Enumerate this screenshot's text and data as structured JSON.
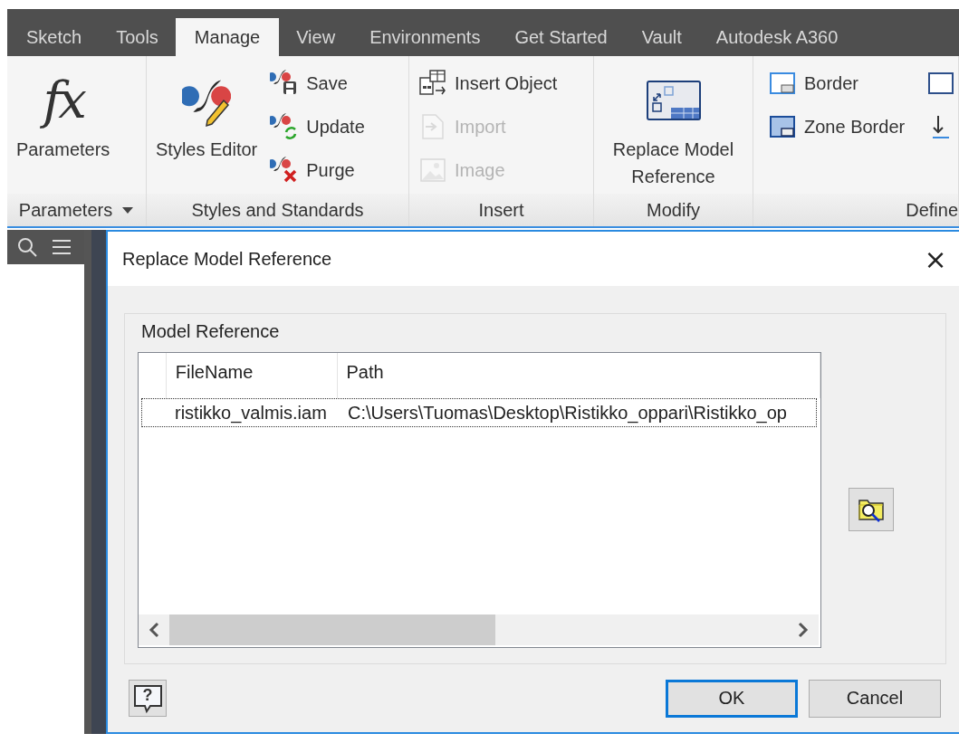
{
  "tabs": [
    {
      "label": "Sketch",
      "selected": false
    },
    {
      "label": "Tools",
      "selected": false
    },
    {
      "label": "Manage",
      "selected": true
    },
    {
      "label": "View",
      "selected": false
    },
    {
      "label": "Environments",
      "selected": false
    },
    {
      "label": "Get Started",
      "selected": false
    },
    {
      "label": "Vault",
      "selected": false
    },
    {
      "label": "Autodesk A360",
      "selected": false
    }
  ],
  "ribbon": {
    "panels": [
      {
        "label": "Parameters",
        "dropdown": true,
        "tools": [
          {
            "kind": "large",
            "icon_text": "fx",
            "label": "Parameters",
            "disabled": false
          }
        ]
      },
      {
        "label": "Styles and Standards",
        "dropdown": false,
        "tools": [
          {
            "kind": "large",
            "label": "Styles Editor",
            "disabled": false
          },
          {
            "kind": "stack",
            "tools": [
              {
                "label": "Save",
                "disabled": false
              },
              {
                "label": "Update",
                "disabled": false
              },
              {
                "label": "Purge",
                "disabled": false
              }
            ]
          }
        ]
      },
      {
        "label": "Insert",
        "dropdown": false,
        "tools": [
          {
            "kind": "stack",
            "tools": [
              {
                "label": "Insert Object",
                "disabled": false
              },
              {
                "label": "Import",
                "disabled": true
              },
              {
                "label": "Image",
                "disabled": true
              }
            ]
          }
        ]
      },
      {
        "label": "Modify",
        "dropdown": false,
        "tools": [
          {
            "kind": "large",
            "label": "Replace Model Reference",
            "disabled": false
          }
        ]
      },
      {
        "label": "Define",
        "dropdown": false,
        "tools": [
          {
            "kind": "stack",
            "tools": [
              {
                "label": "Border",
                "disabled": false
              },
              {
                "label": "Zone Border",
                "disabled": false
              }
            ]
          },
          {
            "kind": "stack",
            "tools": [
              {
                "disabled": false
              },
              {
                "disabled": false
              }
            ]
          }
        ]
      }
    ]
  },
  "dialog": {
    "title": "Replace Model Reference",
    "close": "×",
    "group": "Model Reference",
    "table": {
      "columns": [
        {
          "label": "FileName"
        },
        {
          "label": "Path"
        }
      ],
      "rows": [
        {
          "selected": true,
          "cells": [
            "ristikko_valmis.iam",
            "C:\\Users\\Tuomas\\Desktop\\Ristikko_oppari\\Ristikko_op"
          ]
        }
      ]
    },
    "help": "?",
    "buttons": [
      {
        "label": "OK",
        "default": true
      },
      {
        "label": "Cancel",
        "default": false
      }
    ]
  }
}
